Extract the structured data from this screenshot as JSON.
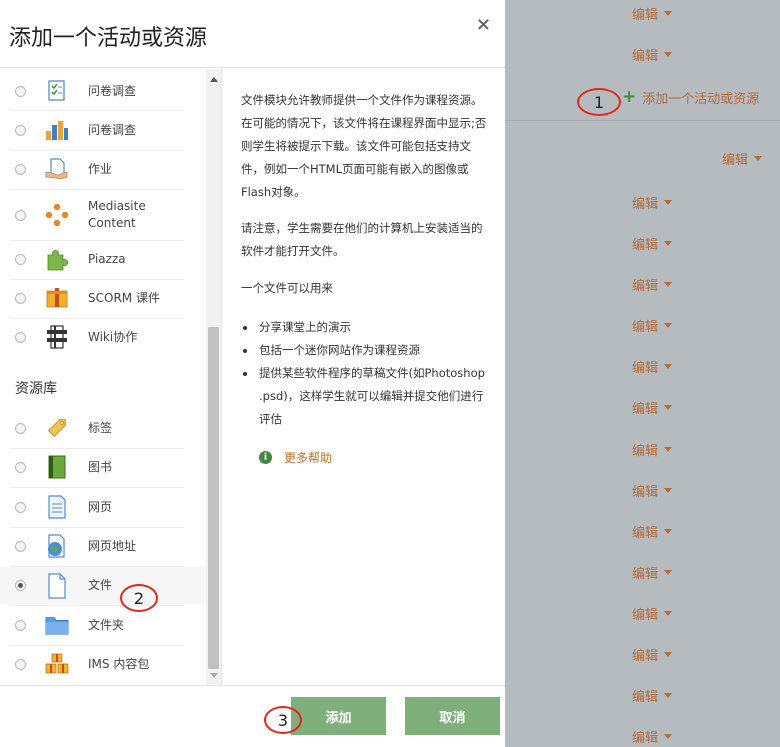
{
  "dialog": {
    "title": "添加一个活动或资源",
    "close": "×",
    "activities": [
      {
        "label": "问卷调查",
        "icon": "questionnaire-icon"
      },
      {
        "label": "问卷调查",
        "icon": "bar-chart-icon"
      },
      {
        "label": "作业",
        "icon": "assignment-icon"
      },
      {
        "label": "Mediasite Content",
        "icon": "mediasite-icon"
      },
      {
        "label": "Piazza",
        "icon": "puzzle-icon"
      },
      {
        "label": "SCORM 课件",
        "icon": "scorm-package-icon"
      },
      {
        "label": "Wiki协作",
        "icon": "wiki-icon"
      }
    ],
    "resources_heading": "资源库",
    "resources": [
      {
        "label": "标签",
        "icon": "tag-icon"
      },
      {
        "label": "图书",
        "icon": "book-icon"
      },
      {
        "label": "网页",
        "icon": "page-icon"
      },
      {
        "label": "网页地址",
        "icon": "url-globe-icon"
      },
      {
        "label": "文件",
        "icon": "file-icon",
        "selected": true
      },
      {
        "label": "文件夹",
        "icon": "folder-icon"
      },
      {
        "label": "IMS 内容包",
        "icon": "ims-package-icon"
      }
    ],
    "description": {
      "p1": "文件模块允许教师提供一个文件作为课程资源。在可能的情况下，该文件将在课程界面中显示;否则学生将被提示下载。该文件可能包括支持文件，例如一个HTML页面可能有嵌入的图像或Flash对象。",
      "p2": "请注意，学生需要在他们的计算机上安装适当的软件才能打开文件。",
      "p3": "一个文件可以用来",
      "bullets": [
        "分享课堂上的演示",
        "包括一个迷你网站作为课程资源",
        "提供某些软件程序的草稿文件(如Photoshop .psd)，这样学生就可以编辑并提交他们进行评估"
      ],
      "more_help": "更多帮助"
    },
    "buttons": {
      "add": "添加",
      "cancel": "取消"
    }
  },
  "background": {
    "edit_label": "编辑",
    "add_activity_label": "添加一个活动或资源"
  },
  "annotations": [
    "1",
    "2",
    "3"
  ],
  "colors": {
    "accent": "#c0701f",
    "button": "#7fb07b",
    "annotation": "#e3261b"
  }
}
